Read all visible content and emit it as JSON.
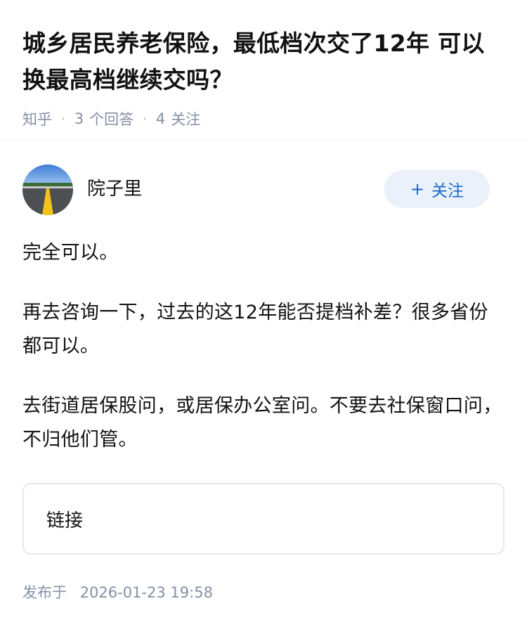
{
  "question": {
    "title": "城乡居民养老保险，最低档次交了12年 可以换最高档继续交吗？",
    "source": "知乎",
    "answer_count": "3",
    "answer_label": "个回答",
    "follower_count": "4",
    "follower_label": "关注"
  },
  "answer": {
    "author": "院子里",
    "follow_button": "关注",
    "paragraphs": [
      "完全可以。",
      "再去咨询一下，过去的这12年能否提档补差？很多省份都可以。",
      "去街道居保股问，或居保办公室问。不要去社保窗口问，不归他们管。"
    ],
    "link_card_label": "链接",
    "published_label": "发布于",
    "published_time": "2026-01-23 19:58"
  },
  "colors": {
    "accent": "#1768c8",
    "accent_bg": "#ebf1fa",
    "meta_text": "#8590a6"
  }
}
